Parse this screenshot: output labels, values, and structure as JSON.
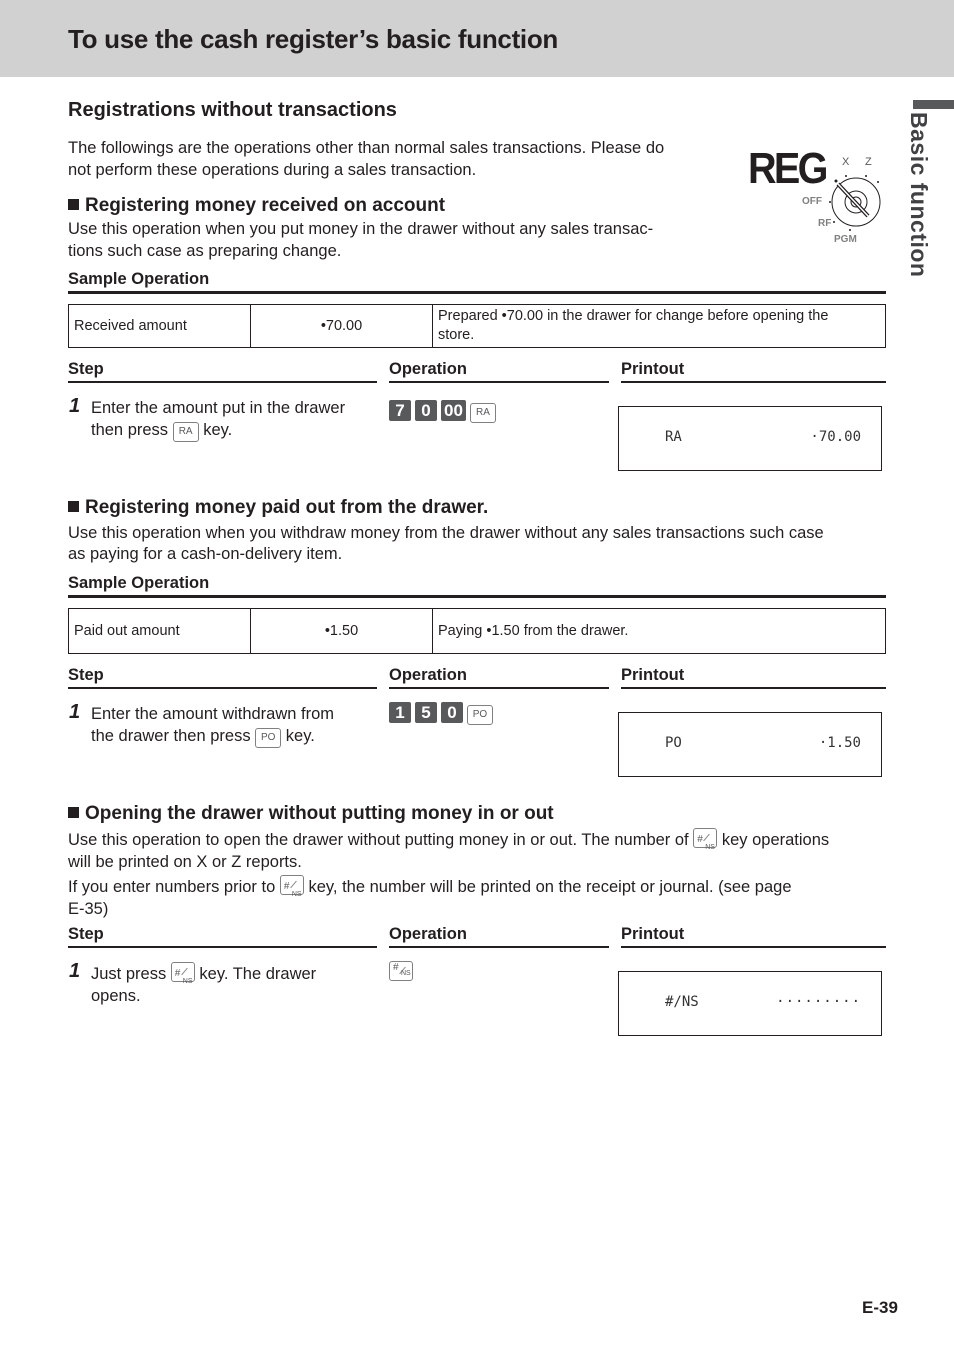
{
  "header": {
    "title": "To use the cash register’s basic function"
  },
  "side_tab": {
    "label": "Basic function"
  },
  "mode_switch": {
    "mode_label": "REG",
    "positions": [
      "X",
      "Z",
      "OFF",
      "RF",
      "PGM"
    ],
    "selected": "REG"
  },
  "section": {
    "title": "Registrations without transactions",
    "intro_line1": "The followings are the operations other than normal sales transactions. Please do",
    "intro_line2": "not perform these operations during a sales transaction."
  },
  "columns": {
    "step": "Step",
    "operation": "Operation",
    "printout": "Printout"
  },
  "received_on_account": {
    "title": "Registering money received on account",
    "desc_line1": "Use this operation when you put money in the drawer without any sales transac-",
    "desc_line2": "tions such case as preparing change.",
    "sample_label": "Sample Operation",
    "table": {
      "item": "Received amount",
      "amount": "•70.00",
      "note_line1": "Prepared •70.00 in the drawer for change before opening the",
      "note_line2": "store."
    },
    "step": {
      "number": "1",
      "text_line1": "Enter the amount put in the drawer",
      "text_line2_pre": "then press",
      "key": "RA",
      "text_line2_post": "key."
    },
    "operation_keys": [
      "7",
      "0",
      "00"
    ],
    "operation_func_key": "RA",
    "printout": {
      "label": "RA",
      "value": "·70.00"
    }
  },
  "paid_out": {
    "title": "Registering money paid out from the drawer.",
    "desc_line1": "Use this operation when you withdraw money from the drawer without any sales transactions such case",
    "desc_line2": "as paying for a cash-on-delivery item.",
    "sample_label": "Sample Operation",
    "table": {
      "item": "Paid out amount",
      "amount": "•1.50",
      "note": "Paying •1.50 from the drawer."
    },
    "step": {
      "number": "1",
      "text_line1": "Enter the amount withdrawn from",
      "text_line2_pre": "the drawer then press",
      "key": "PO",
      "text_line2_post": "key."
    },
    "operation_keys": [
      "1",
      "5",
      "0"
    ],
    "operation_func_key": "PO",
    "printout": {
      "label": "PO",
      "value": "·1.50"
    }
  },
  "no_sale": {
    "title": "Opening the drawer without putting money in or out",
    "desc1_pre": "Use this operation to open the drawer without putting money in or out. The number of",
    "desc1_post": "key operations",
    "desc1_line2": "will be printed on X or Z reports.",
    "desc2_pre": "If you enter numbers prior to",
    "desc2_post": "key, the number will be printed on the receipt or journal. (see page",
    "desc2_line2": "E-35)",
    "key_hash": "#",
    "key_ns": "NS",
    "step": {
      "number": "1",
      "text_pre": "Just press",
      "text_post": "key. The drawer",
      "text_line2": "opens."
    },
    "printout": {
      "label": "#/NS",
      "value": "·········"
    }
  },
  "footer": {
    "page_number": "E-39"
  }
}
